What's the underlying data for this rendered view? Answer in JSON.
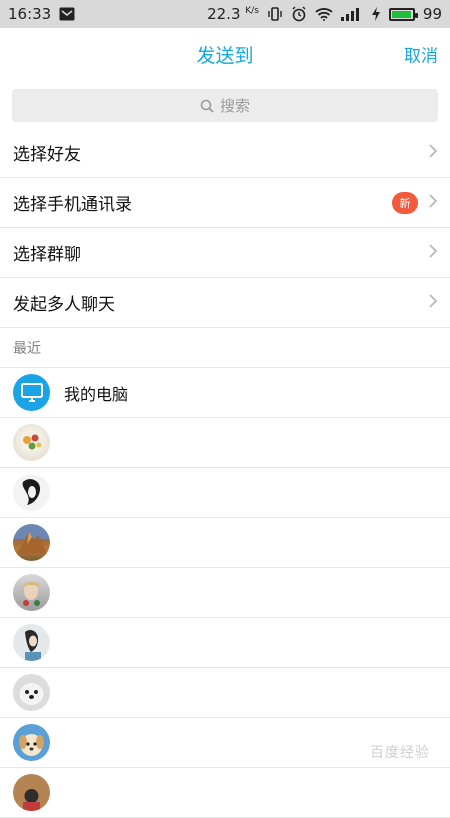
{
  "status_bar": {
    "time": "16:33",
    "speed": "22.3",
    "speed_unit": "K/s",
    "battery_level": "99",
    "battery_fraction": 0.95
  },
  "header": {
    "title": "发送到",
    "cancel": "取消"
  },
  "search": {
    "placeholder": "搜索"
  },
  "menu": [
    {
      "label": "选择好友"
    },
    {
      "label": "选择手机通讯录",
      "badge": "新"
    },
    {
      "label": "选择群聊"
    },
    {
      "label": "发起多人聊天"
    }
  ],
  "recent": {
    "section_label": "最近",
    "my_computer": "我的电脑"
  },
  "watermark": "百度经验",
  "colors": {
    "accent": "#14a7e0",
    "badge": "#f25a3c",
    "status_bar": "#d9d9d9"
  }
}
